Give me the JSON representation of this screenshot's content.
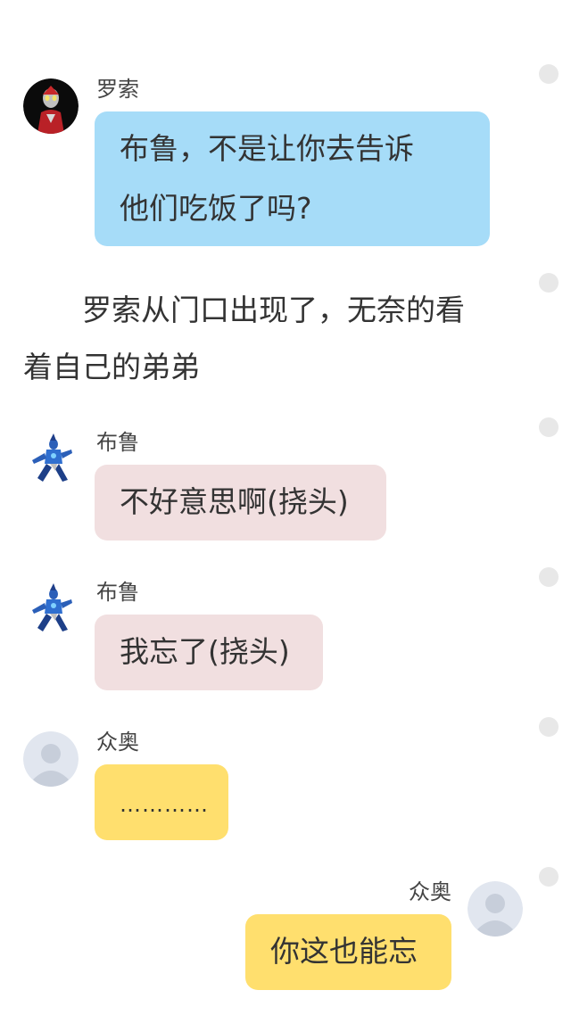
{
  "messages": [
    {
      "speaker": "罗索",
      "line1": "布鲁，不是让你去告诉",
      "line2": "他们吃饭了吗?",
      "bubble_color": "#a6dcf8"
    },
    {
      "narration_line1": "罗索从门口出现了，无奈的看",
      "narration_line2": "着自己的弟弟"
    },
    {
      "speaker": "布鲁",
      "text": "不好意思啊(挠头)",
      "bubble_color": "#f1dfe0"
    },
    {
      "speaker": "布鲁",
      "text": "我忘了(挠头)",
      "bubble_color": "#f1dfe0"
    },
    {
      "speaker": "众奥",
      "text": "…………",
      "bubble_color": "#ffdf6e"
    },
    {
      "speaker": "众奥",
      "text": "你这也能忘",
      "bubble_color": "#ffdf6e",
      "side": "right"
    }
  ],
  "icons": {
    "rosso": "rosso-avatar-icon",
    "blu": "blu-avatar-icon",
    "default": "default-avatar-icon",
    "dot": "circle-dot-icon"
  }
}
